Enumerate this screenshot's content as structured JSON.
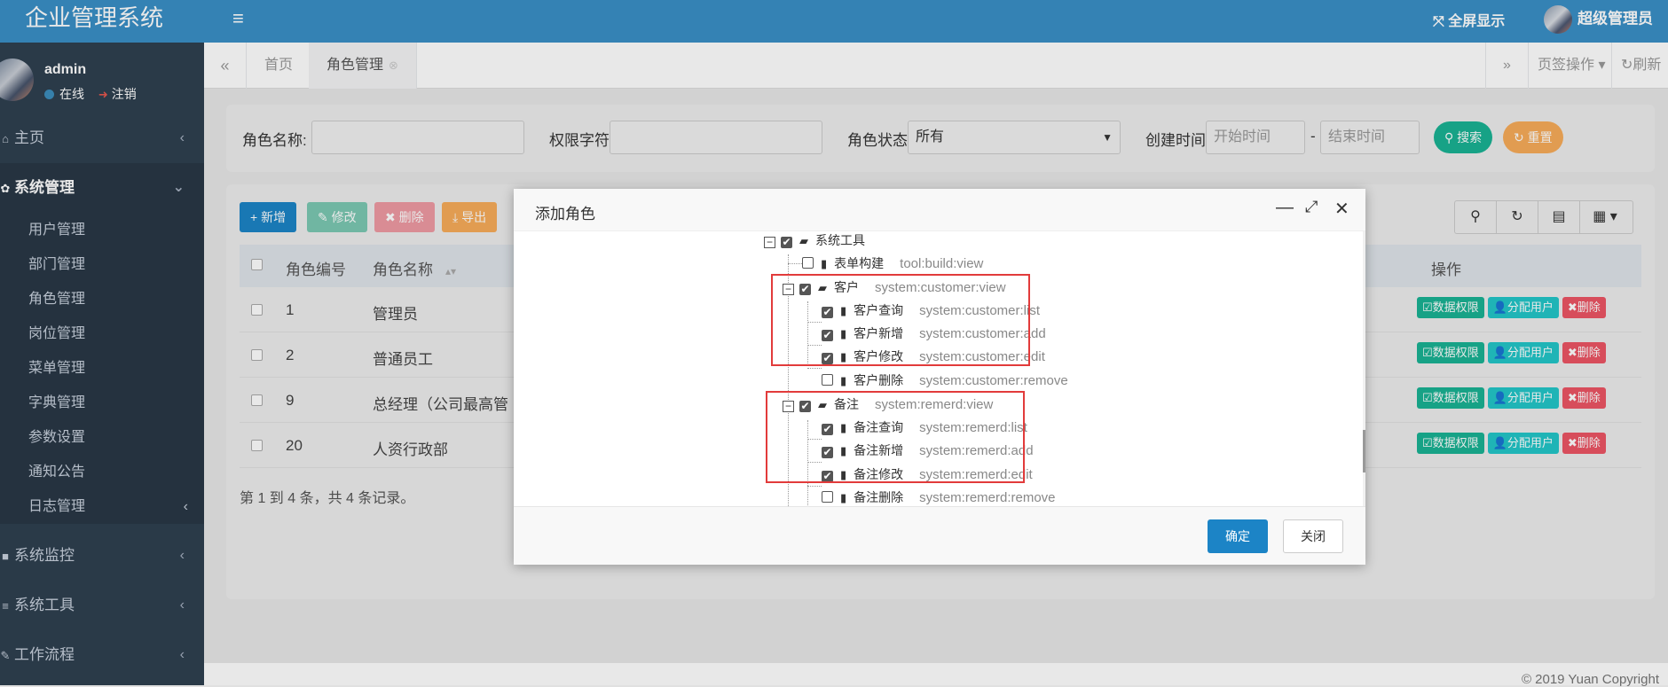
{
  "app": {
    "title": "企业管理系统"
  },
  "user": {
    "name": "admin",
    "status": "在线",
    "logout": "注销",
    "top_name": "超级管理员"
  },
  "topbar": {
    "fullscreen": "全屏显示"
  },
  "sidebar": {
    "items": [
      {
        "label": "主页",
        "icon": "home-icon"
      },
      {
        "label": "系统管理",
        "icon": "gear-icon",
        "expanded": true
      },
      {
        "label": "系统监控",
        "icon": "video-icon"
      },
      {
        "label": "系统工具",
        "icon": "list-icon"
      },
      {
        "label": "工作流程",
        "icon": "wrench-icon"
      }
    ],
    "sub": [
      "用户管理",
      "部门管理",
      "角色管理",
      "岗位管理",
      "菜单管理",
      "字典管理",
      "参数设置",
      "通知公告",
      "日志管理"
    ]
  },
  "tabs": {
    "items": [
      "首页",
      "角色管理"
    ],
    "page_ops": "页签操作",
    "refresh": "刷新"
  },
  "search": {
    "role_name_label": "角色名称:",
    "perm_label": "权限字符:",
    "status_label": "角色状态:",
    "status_value": "所有",
    "created_label": "创建时间:",
    "start_placeholder": "开始时间",
    "dash": "-",
    "end_placeholder": "结束时间",
    "search_btn": "搜索",
    "reset_btn": "重置"
  },
  "toolbar": {
    "add": "新增",
    "edit": "修改",
    "delete": "删除",
    "export": "导出"
  },
  "table": {
    "headers": {
      "id": "角色编号",
      "name": "角色名称",
      "ops": "操作"
    },
    "rows": [
      {
        "id": "1",
        "name": "管理员"
      },
      {
        "id": "2",
        "name": "普通员工"
      },
      {
        "id": "9",
        "name": "总经理（公司最高管"
      },
      {
        "id": "20",
        "name": "人资行政部"
      }
    ],
    "op_labels": {
      "data_perm": "数据权限",
      "assign": "分配用户",
      "delete": "删除"
    },
    "pager": "第 1 到 4 条，共 4 条记录。"
  },
  "modal": {
    "title": "添加角色",
    "ok": "确定",
    "close": "关闭",
    "tree": [
      {
        "label": "系统工具",
        "perm": "",
        "type": "folder",
        "checked": true,
        "expanded": true
      },
      {
        "label": "表单构建",
        "perm": "tool:build:view",
        "type": "file",
        "checked": false
      },
      {
        "label": "客户",
        "perm": "system:customer:view",
        "type": "folder",
        "checked": true,
        "expanded": true
      },
      {
        "label": "客户查询",
        "perm": "system:customer:list",
        "type": "file",
        "checked": true
      },
      {
        "label": "客户新增",
        "perm": "system:customer:add",
        "type": "file",
        "checked": true
      },
      {
        "label": "客户修改",
        "perm": "system:customer:edit",
        "type": "file",
        "checked": true
      },
      {
        "label": "客户删除",
        "perm": "system:customer:remove",
        "type": "file",
        "checked": false
      },
      {
        "label": "备注",
        "perm": "system:remerd:view",
        "type": "folder",
        "checked": true,
        "expanded": true
      },
      {
        "label": "备注查询",
        "perm": "system:remerd:list",
        "type": "file",
        "checked": true
      },
      {
        "label": "备注新增",
        "perm": "system:remerd:add",
        "type": "file",
        "checked": true
      },
      {
        "label": "备注修改",
        "perm": "system:remerd:edit",
        "type": "file",
        "checked": true
      },
      {
        "label": "备注删除",
        "perm": "system:remerd:remove",
        "type": "file",
        "checked": false
      }
    ]
  },
  "footer": {
    "copyright": "© 2019 Yuan Copyright"
  },
  "colors": {
    "sidebar": "#2f4050",
    "topbar": "#3a8fc6",
    "primary": "#1c84c6",
    "success": "#1ab394",
    "danger": "#ed5565",
    "warning": "#f8ac59",
    "highlight": "#e23b3b"
  }
}
